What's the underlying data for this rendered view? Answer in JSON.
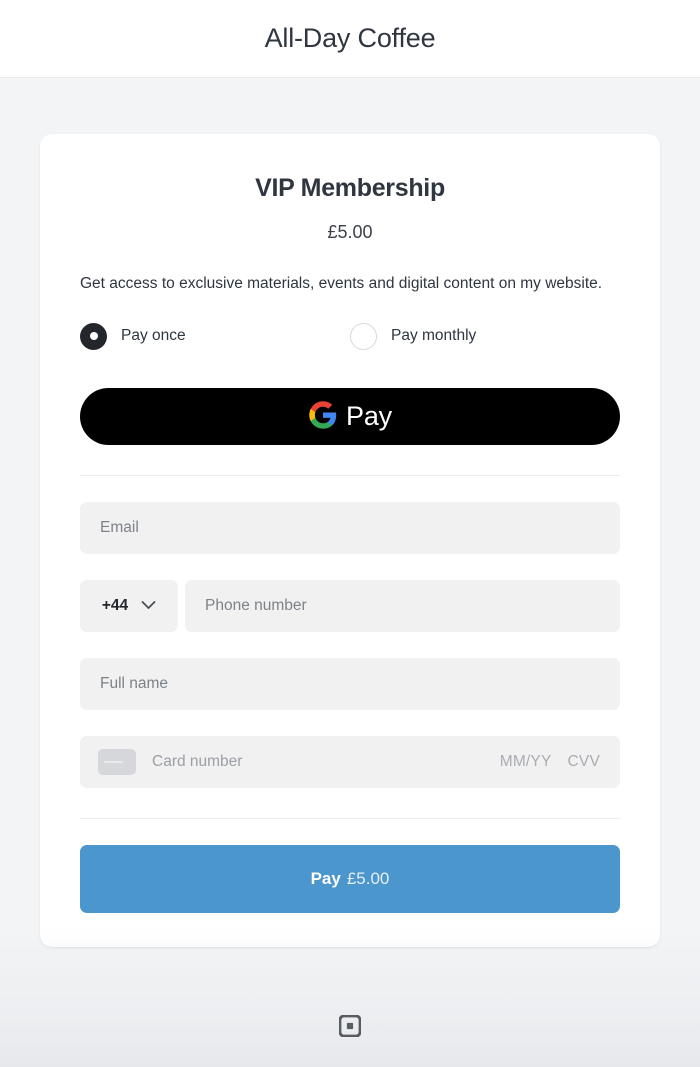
{
  "header": {
    "merchant_title": "All-Day Coffee"
  },
  "checkout": {
    "plan_title": "VIP Membership",
    "price": "£5.00",
    "description": "Get access to exclusive materials, events and digital content on my website.",
    "billing_options": [
      {
        "label": "Pay once",
        "selected": true
      },
      {
        "label": "Pay monthly",
        "selected": false
      }
    ],
    "google_pay": {
      "label": "Pay",
      "icon": "google-g-icon"
    },
    "form": {
      "email_placeholder": "Email",
      "country_code": "+44",
      "country_chevron_icon": "chevron-down-icon",
      "phone_placeholder": "Phone number",
      "fullname_placeholder": "Full name",
      "card_icon": "credit-card-icon",
      "card_number_placeholder": "Card number",
      "expiry_placeholder": "MM/YY",
      "cvv_placeholder": "CVV"
    },
    "submit": {
      "action_label": "Pay",
      "amount_label": "£5.00"
    }
  },
  "footer": {
    "logo_icon": "square-logo-icon"
  },
  "colors": {
    "page_background": "#f3f4f6",
    "card_background": "#ffffff",
    "text_primary": "#2f3640",
    "text_placeholder": "#7d8288",
    "field_background": "#f1f1f2",
    "gpay_background": "#000000",
    "pay_button": "#4b96cd",
    "radio_selected": "#23272b",
    "square_logo": "#585c63"
  }
}
